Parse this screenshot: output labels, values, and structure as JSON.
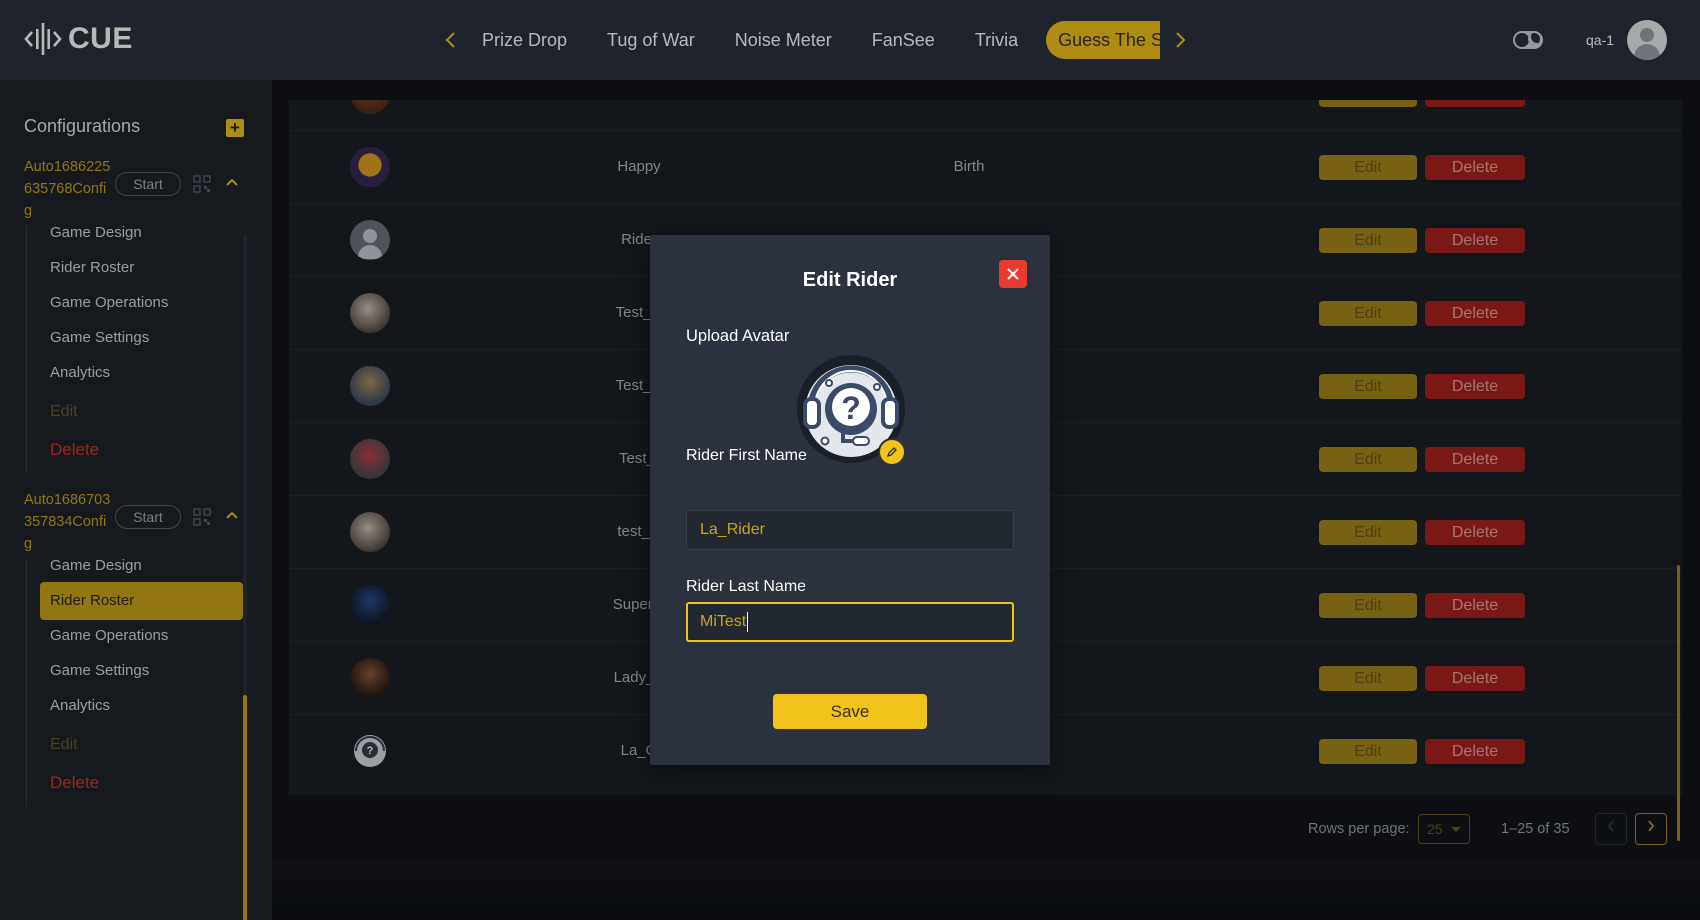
{
  "app": {
    "name": "CUE"
  },
  "nav": {
    "tabs": [
      "Prize Drop",
      "Tug of War",
      "Noise Meter",
      "FanSee",
      "Trivia",
      "Guess The Score"
    ],
    "active_tab": "Guess The Score"
  },
  "user": {
    "name": "qa-1"
  },
  "sidebar": {
    "title": "Configurations",
    "configs": [
      {
        "name": "Auto1686225635768Config",
        "start_label": "Start",
        "items": [
          "Game Design",
          "Rider Roster",
          "Game Operations",
          "Game Settings",
          "Analytics"
        ],
        "edit_label": "Edit",
        "delete_label": "Delete"
      },
      {
        "name": "Auto1686703357834Config",
        "start_label": "Start",
        "items": [
          "Game Design",
          "Rider Roster",
          "Game Operations",
          "Game Settings",
          "Analytics"
        ],
        "active_item": "Rider Roster",
        "edit_label": "Edit",
        "delete_label": "Delete"
      }
    ]
  },
  "table": {
    "rows": [
      {
        "first": "Happy",
        "last": "Birth",
        "avatar": "halloween"
      },
      {
        "first": "Rider",
        "last": "",
        "avatar": "default"
      },
      {
        "first": "Test_U",
        "last": "",
        "avatar": "photo"
      },
      {
        "first": "Test_N",
        "last": "",
        "avatar": "photo"
      },
      {
        "first": "Test_I",
        "last": "",
        "avatar": "photo"
      },
      {
        "first": "test_D",
        "last": "",
        "avatar": "photo"
      },
      {
        "first": "Super_I",
        "last": "",
        "avatar": "photo"
      },
      {
        "first": "Lady_V",
        "last": "",
        "avatar": "photo"
      },
      {
        "first": "La_G",
        "last": "",
        "avatar": "placeholder"
      }
    ],
    "edit_label": "Edit",
    "delete_label": "Delete"
  },
  "pagination": {
    "rows_per_page_label": "Rows per page:",
    "rows_per_page": "25",
    "range": "1–25 of 35"
  },
  "modal": {
    "title": "Edit Rider",
    "upload_label": "Upload Avatar",
    "first_name_label": "Rider First Name",
    "first_name_value": "La_Rider",
    "last_name_label": "Rider Last Name",
    "last_name_value": "MiTest",
    "save_label": "Save"
  },
  "colors": {
    "accent": "#f2c31b",
    "danger": "#e63b2e",
    "topbar": "#2b323d",
    "sidebar": "#1f242c"
  }
}
